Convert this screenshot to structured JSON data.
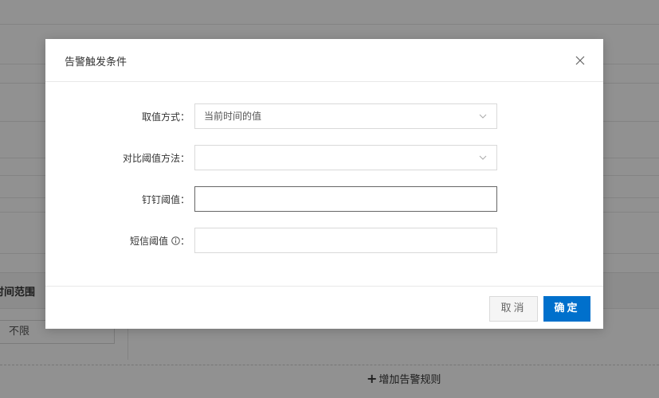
{
  "background": {
    "column_title": "时间范围",
    "time_range_value": "不限",
    "add_rule_label": "增加告警规则"
  },
  "dialog": {
    "title": "告警触发条件",
    "fields": {
      "value_mode": {
        "label": "取值方式：",
        "value": "当前时间的值"
      },
      "compare_method": {
        "label": "对比阈值方法：",
        "value": ""
      },
      "dingtalk_threshold": {
        "label": "钉钉阈值：",
        "value": ""
      },
      "sms_threshold": {
        "label": "短信阈值",
        "colon": "：",
        "value": ""
      }
    },
    "buttons": {
      "cancel": "取消",
      "ok": "确定"
    }
  },
  "colors": {
    "primary": "#0070cc",
    "overlay": "rgba(0,0,0,0.43)"
  },
  "icons": {
    "close": "close-icon",
    "dropdown": "chevron-down-icon",
    "info": "info-icon",
    "add": "plus-icon"
  }
}
